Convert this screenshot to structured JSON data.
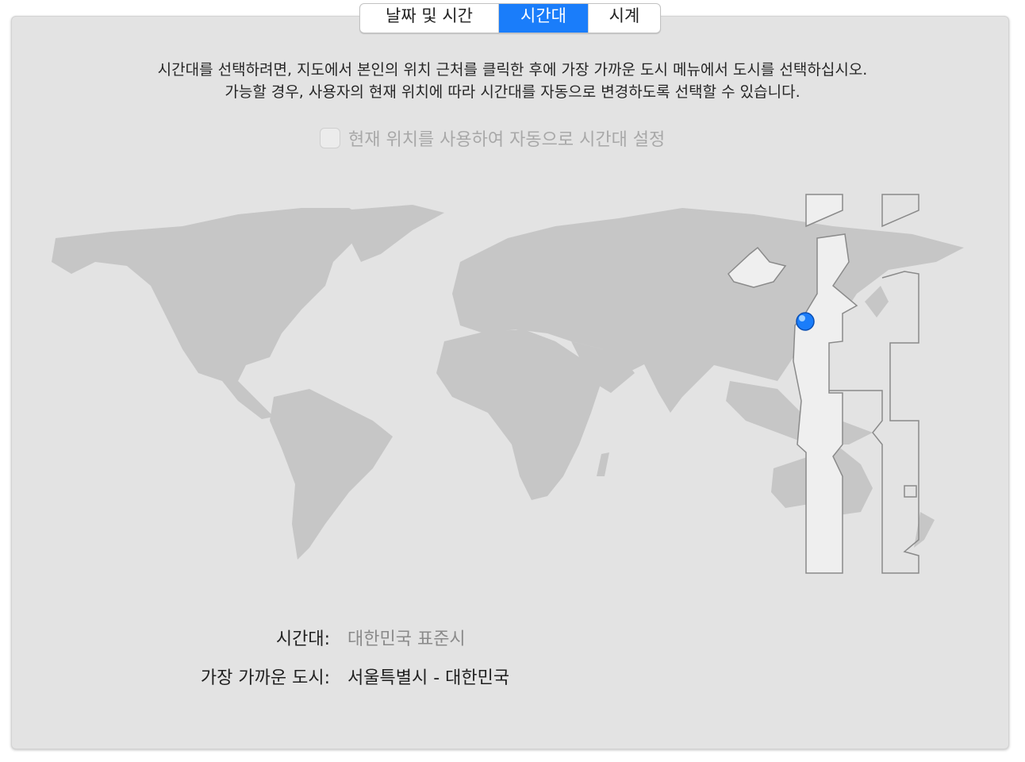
{
  "tabs": [
    {
      "label": "날짜 및 시간",
      "selected": false
    },
    {
      "label": "시간대",
      "selected": true
    },
    {
      "label": "시계",
      "selected": false
    }
  ],
  "description": {
    "line1": "시간대를 선택하려면, 지도에서 본인의 위치 근처를 클릭한 후에 가장 가까운 도시 메뉴에서 도시를 선택하십시오.",
    "line2": "가능할 경우, 사용자의 현재 위치에 따라 시간대를 자동으로 변경하도록 선택할 수 있습니다."
  },
  "auto_timezone": {
    "label": "현재 위치를 사용하여 자동으로 시간대 설정",
    "checked": false,
    "enabled": false
  },
  "info": {
    "timezone_label": "시간대:",
    "timezone_value": "대한민국 표준시",
    "city_label": "가장 가까운 도시:",
    "city_value": "서울특별시 - 대한민국"
  },
  "colors": {
    "accent": "#1a7dfa",
    "land": "#c6c6c6",
    "selected_zone": "#f0f0f0",
    "panel": "#e3e3e3"
  }
}
